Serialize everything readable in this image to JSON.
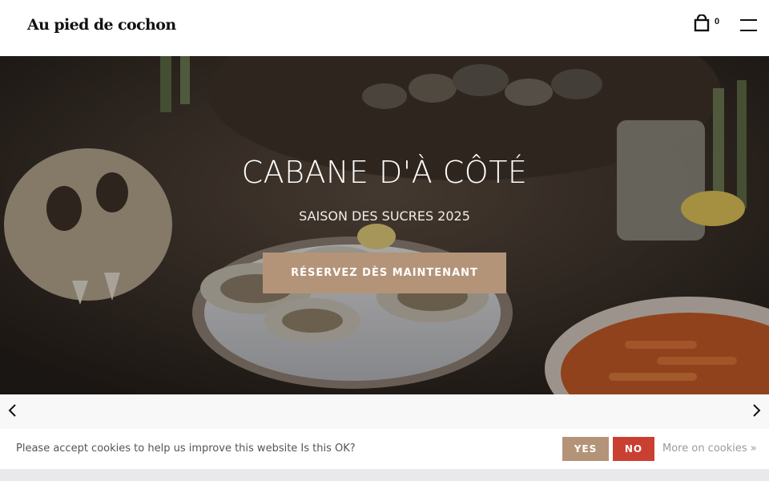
{
  "header": {
    "logo_text": "Au pied de cochon",
    "cart_count": "0",
    "cart_icon": "shopping-bag-icon",
    "menu_icon": "hamburger-menu-icon"
  },
  "hero": {
    "title": "CABANE D'À CÔTÉ",
    "subtitle": "SAISON DES SUCRES 2025",
    "cta_label": "RÉSERVEZ DÈS MAINTENANT",
    "image": "oysters-on-ice-table-photo"
  },
  "slider": {
    "prev_icon": "chevron-left-icon",
    "next_icon": "chevron-right-icon"
  },
  "cookie_bar": {
    "message": "Please accept cookies to help us improve this website Is this OK?",
    "yes_label": "YES",
    "no_label": "NO",
    "more_link": "More on cookies »"
  },
  "colors": {
    "accent": "#b49478",
    "decline": "#c94031",
    "header_bg": "#ffffff",
    "text_dark": "#111111"
  }
}
